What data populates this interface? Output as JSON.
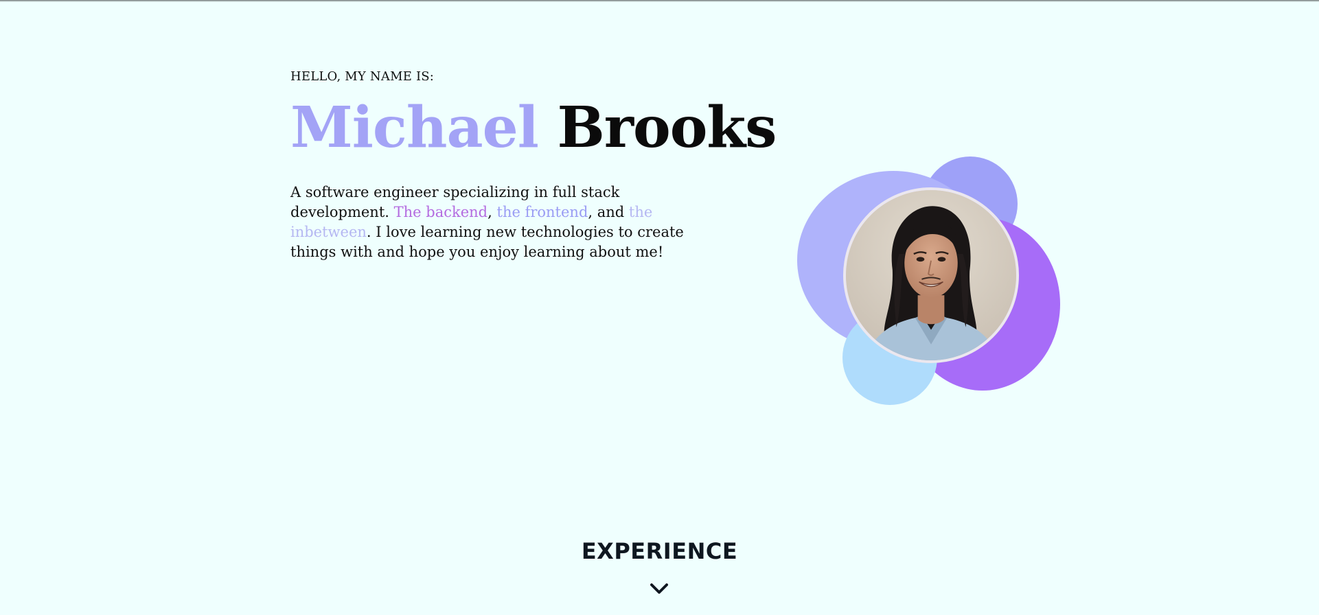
{
  "hero": {
    "greeting": "HELLO, MY NAME IS:",
    "first_name": "Michael",
    "last_name": "Brooks",
    "bio": {
      "intro": "A software engineer specializing in full stack development.",
      "backend": "The backend",
      "sep1": ",",
      "frontend": "the frontend",
      "and": ", and",
      "inbetween": "the inbetween",
      "outro": ". I love learning new technologies to create things with and hope you enjoy learning about me!"
    }
  },
  "portrait": {
    "icon": "portrait-photo",
    "blob_colors": [
      "#9ea1f8",
      "#afb3fb",
      "#a76cf8",
      "#afdcfc"
    ]
  },
  "next_section": {
    "heading": "EXPERIENCE",
    "icon": "chevron-down-icon"
  },
  "colors": {
    "background": "#effffe",
    "accent_name": "#a3a3f6",
    "backend": "#b46be0",
    "frontend": "#9a9cf4",
    "inbetween": "#b5b7f2"
  }
}
